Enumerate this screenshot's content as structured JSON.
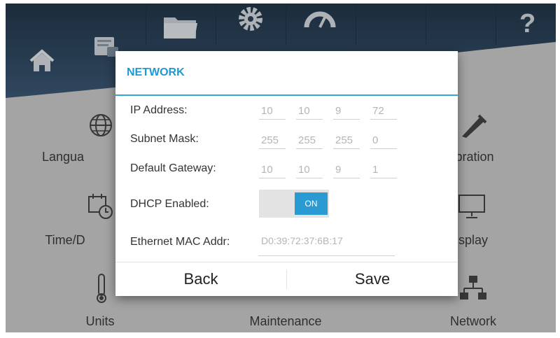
{
  "toolbar": {
    "icons": [
      "home-icon",
      "report-icon",
      "folder-icon",
      "gear-icon",
      "gauge-icon",
      "help-icon"
    ],
    "help_glyph": "?"
  },
  "tiles": {
    "language": "Langua",
    "calibration": "ibration",
    "time": "Time/D",
    "display": "isplay",
    "units": "Units",
    "maintenance": "Maintenance",
    "network": "Network"
  },
  "dialog": {
    "title": "NETWORK",
    "ip": {
      "label": "IP Address:",
      "octets": [
        "10",
        "10",
        "9",
        "72"
      ]
    },
    "subnet": {
      "label": "Subnet Mask:",
      "octets": [
        "255",
        "255",
        "255",
        "0"
      ]
    },
    "gateway": {
      "label": "Default Gateway:",
      "octets": [
        "10",
        "10",
        "9",
        "1"
      ]
    },
    "dhcp": {
      "label": "DHCP Enabled:",
      "state": "ON"
    },
    "mac": {
      "label": "Ethernet MAC Addr:",
      "value": "D0:39:72:37:6B:17"
    },
    "back": "Back",
    "save": "Save"
  },
  "colors": {
    "accent": "#1b9ad6",
    "toggle_on": "#2a9ad3",
    "header_dark": "#2a3f55"
  }
}
